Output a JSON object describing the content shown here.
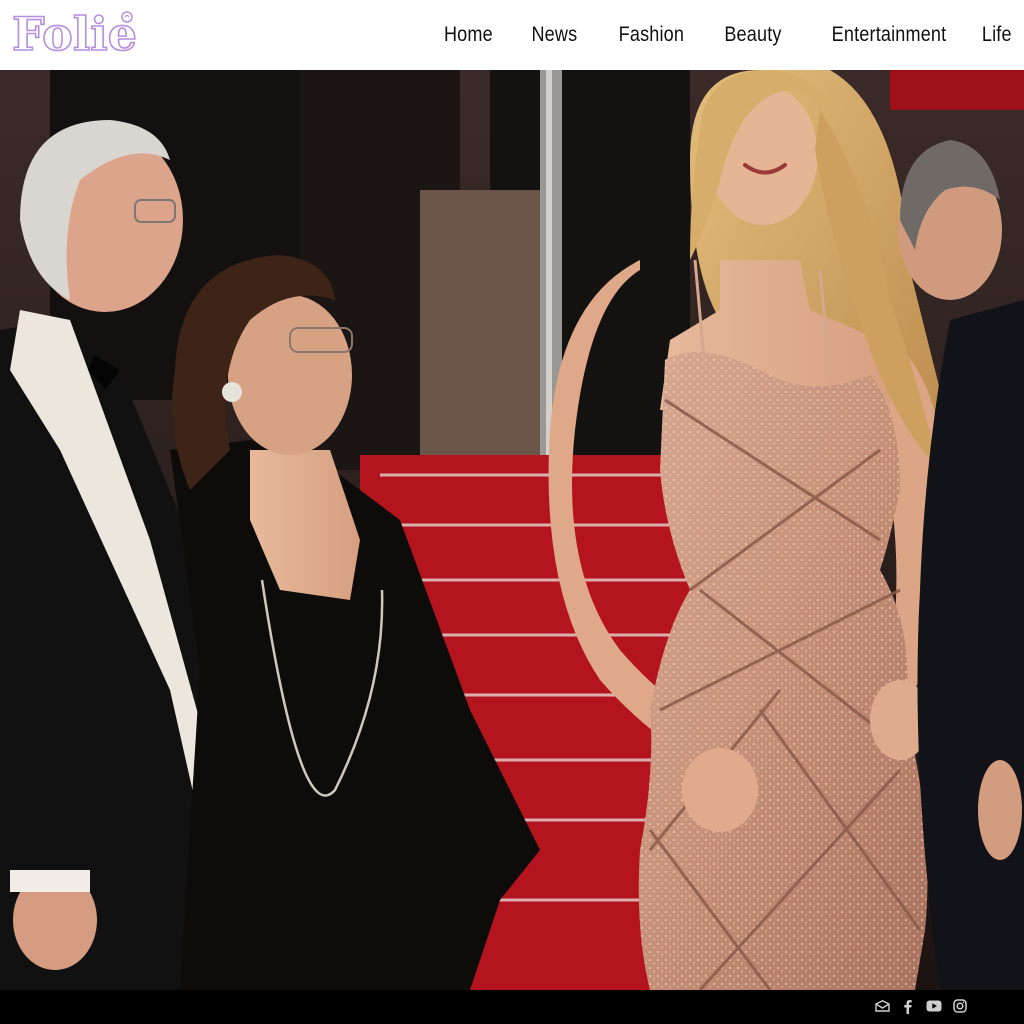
{
  "brand": {
    "name": "Folie",
    "accent_color": "#b78fe0"
  },
  "nav": {
    "items": [
      {
        "label": "Home"
      },
      {
        "label": "News"
      },
      {
        "label": "Fashion"
      },
      {
        "label": "Beauty"
      },
      {
        "label": "Entertainment"
      },
      {
        "label": "Life"
      }
    ]
  },
  "footer": {
    "social_icons": [
      "mail-icon",
      "facebook-icon",
      "youtube-icon",
      "instagram-icon"
    ]
  }
}
